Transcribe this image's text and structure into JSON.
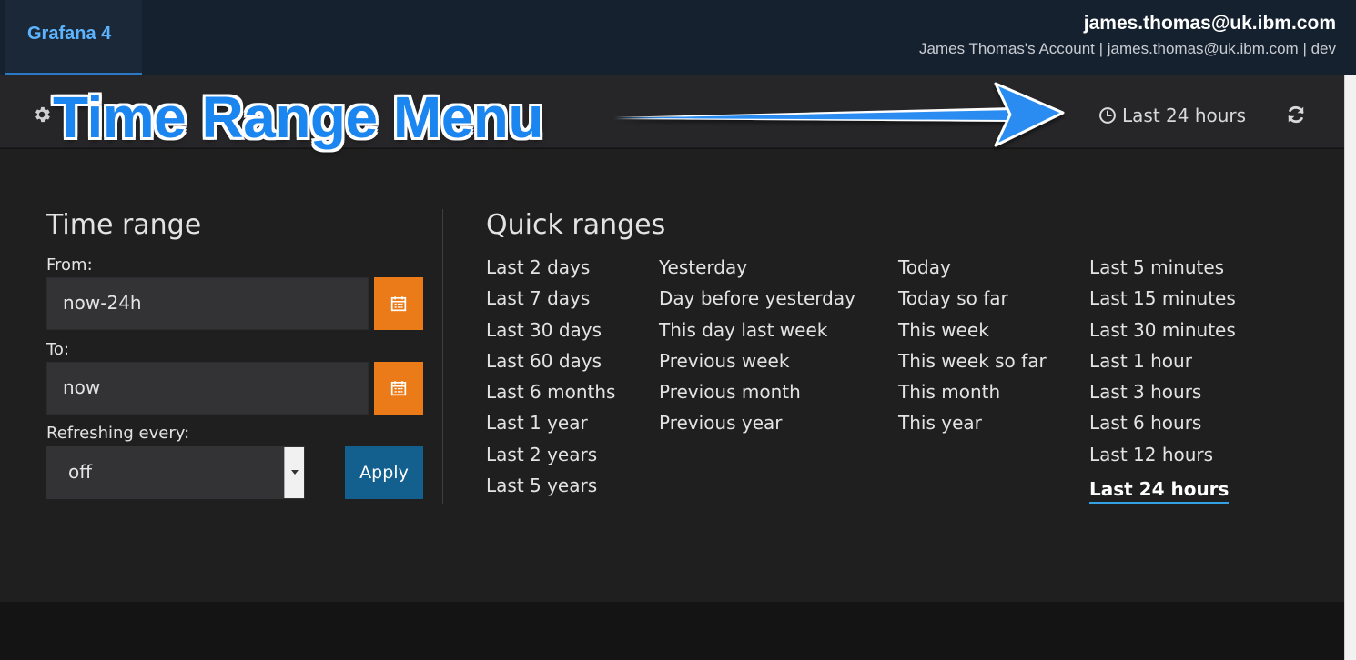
{
  "topbar": {
    "app_tab": "Grafana 4",
    "user_email": "james.thomas@uk.ibm.com",
    "account_line": "James Thomas's Account | james.thomas@uk.ibm.com | dev"
  },
  "navbar": {
    "time_picker_label": "Last 24 hours",
    "icons": [
      "gear-icon",
      "clock-icon",
      "refresh-icon"
    ]
  },
  "annotation": {
    "title": "Time Range Menu"
  },
  "time_range": {
    "heading": "Time range",
    "from_label": "From:",
    "from_value": "now-24h",
    "to_label": "To:",
    "to_value": "now",
    "refresh_label": "Refreshing every:",
    "refresh_value": "off",
    "apply_label": "Apply"
  },
  "quick_ranges": {
    "heading": "Quick ranges",
    "columns": [
      [
        "Last 2 days",
        "Last 7 days",
        "Last 30 days",
        "Last 60 days",
        "Last 6 months",
        "Last 1 year",
        "Last 2 years",
        "Last 5 years"
      ],
      [
        "Yesterday",
        "Day before yesterday",
        "This day last week",
        "Previous week",
        "Previous month",
        "Previous year"
      ],
      [
        "Today",
        "Today so far",
        "This week",
        "This week so far",
        "This month",
        "This year"
      ],
      [
        "Last 5 minutes",
        "Last 15 minutes",
        "Last 30 minutes",
        "Last 1 hour",
        "Last 3 hours",
        "Last 6 hours",
        "Last 12 hours",
        "Last 24 hours"
      ]
    ],
    "active": "Last 24 hours"
  },
  "colors": {
    "accent_orange": "#eb7b18",
    "apply_blue": "#13608f",
    "annotation_blue": "#1b86f0",
    "active_underline": "#33a2e5"
  }
}
